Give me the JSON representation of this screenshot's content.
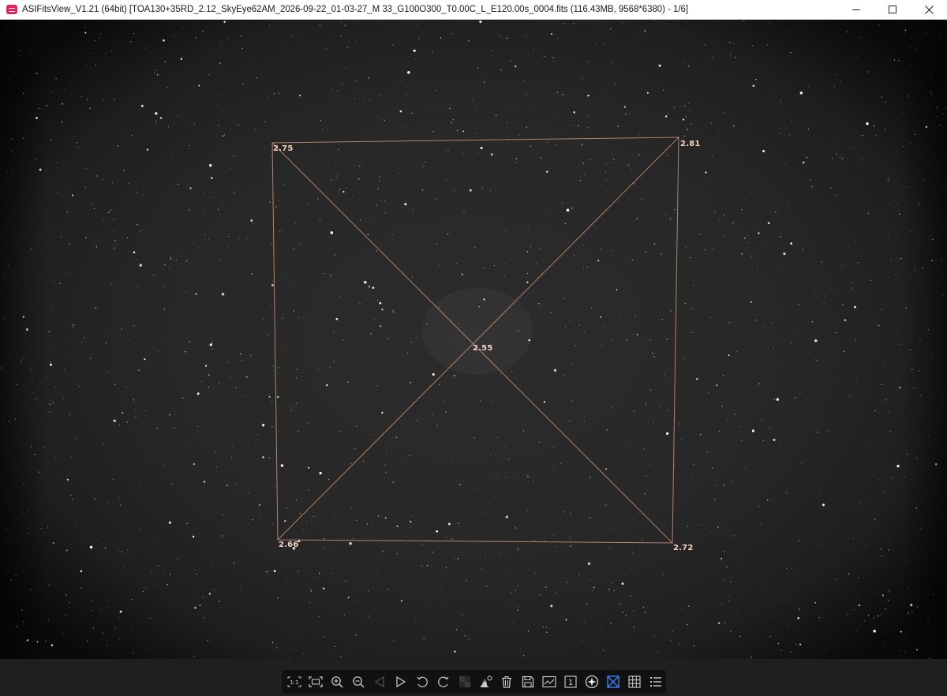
{
  "window": {
    "title": "ASIFitsView_V1.21 (64bit) [TOA130+35RD_2.12_SkyEye62AM_2026-09-22_01-03-27_M 33_G100O300_T0.00C_L_E120.00s_0004.fits (116.43MB, 9568*6380) - 1/6]",
    "controls": [
      "minimize-icon",
      "maximize-icon",
      "close-icon"
    ]
  },
  "tilt_overlay": {
    "color": "#c8937a",
    "labels": {
      "top_left": "2.75",
      "top_right": "2.81",
      "center": "2.55",
      "bottom_left": "2.66",
      "bottom_right": "2.72"
    }
  },
  "toolbar": {
    "buttons": [
      {
        "name": "actual-size-button",
        "icon": "one-to-one-icon",
        "text": "1:1"
      },
      {
        "name": "fit-window-button",
        "icon": "fit-window-icon"
      },
      {
        "name": "zoom-in-button",
        "icon": "zoom-in-icon"
      },
      {
        "name": "zoom-out-button",
        "icon": "zoom-out-icon"
      },
      {
        "name": "previous-image-button",
        "icon": "triangle-left-icon",
        "disabled": true
      },
      {
        "name": "next-image-button",
        "icon": "triangle-right-icon"
      },
      {
        "name": "rotate-left-button",
        "icon": "rotate-ccw-icon"
      },
      {
        "name": "rotate-right-button",
        "icon": "rotate-cw-icon"
      },
      {
        "name": "stretch-button",
        "icon": "stretch-icon",
        "disabled": true
      },
      {
        "name": "histogram-button",
        "icon": "histogram-icon"
      },
      {
        "name": "delete-button",
        "icon": "trash-icon"
      },
      {
        "name": "save-button",
        "icon": "save-icon"
      },
      {
        "name": "fits-header-button",
        "icon": "chart-icon"
      },
      {
        "name": "single-frame-button",
        "icon": "frame-one-icon",
        "text": "1"
      },
      {
        "name": "star-detect-button",
        "icon": "star-circle-icon"
      },
      {
        "name": "tilt-analysis-button",
        "icon": "tilt-icon",
        "active": true
      },
      {
        "name": "grid-button",
        "icon": "grid-icon"
      },
      {
        "name": "menu-list-button",
        "icon": "list-icon"
      }
    ]
  }
}
